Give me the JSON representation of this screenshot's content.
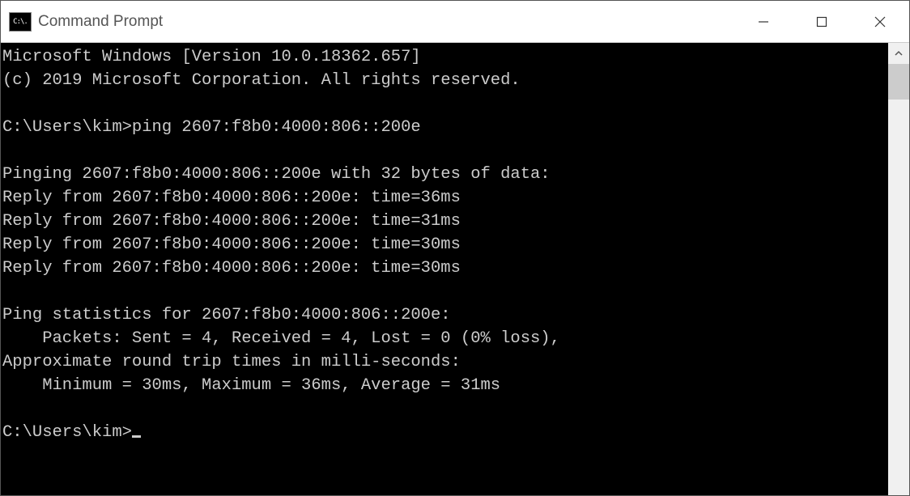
{
  "window": {
    "title": "Command Prompt"
  },
  "terminal": {
    "lines": [
      "Microsoft Windows [Version 10.0.18362.657]",
      "(c) 2019 Microsoft Corporation. All rights reserved.",
      "",
      "C:\\Users\\kim>ping 2607:f8b0:4000:806::200e",
      "",
      "Pinging 2607:f8b0:4000:806::200e with 32 bytes of data:",
      "Reply from 2607:f8b0:4000:806::200e: time=36ms",
      "Reply from 2607:f8b0:4000:806::200e: time=31ms",
      "Reply from 2607:f8b0:4000:806::200e: time=30ms",
      "Reply from 2607:f8b0:4000:806::200e: time=30ms",
      "",
      "Ping statistics for 2607:f8b0:4000:806::200e:",
      "    Packets: Sent = 4, Received = 4, Lost = 0 (0% loss),",
      "Approximate round trip times in milli-seconds:",
      "    Minimum = 30ms, Maximum = 36ms, Average = 31ms",
      "",
      "C:\\Users\\kim>"
    ]
  }
}
